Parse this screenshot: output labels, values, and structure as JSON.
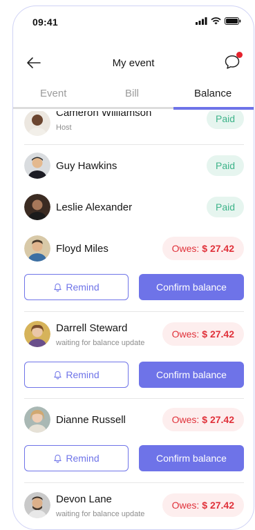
{
  "status_bar": {
    "time": "09:41"
  },
  "header": {
    "title": "My event"
  },
  "tabs": [
    {
      "label": "Event"
    },
    {
      "label": "Bill"
    },
    {
      "label": "Balance"
    }
  ],
  "buttons": {
    "remind": "Remind",
    "confirm": "Confirm balance"
  },
  "owes_label": "Owes:",
  "people": [
    {
      "name": "Cameron Williamson",
      "subtitle": "Host",
      "status": "Paid"
    },
    {
      "name": "Guy Hawkins",
      "status": "Paid"
    },
    {
      "name": "Leslie Alexander",
      "status": "Paid"
    },
    {
      "name": "Floyd Miles",
      "amount": "$ 27.42"
    },
    {
      "name": "Darrell Steward",
      "subtitle": "waiting for balance update",
      "amount": "$ 27.42"
    },
    {
      "name": "Dianne Russell",
      "amount": "$ 27.42"
    },
    {
      "name": "Devon Lane",
      "subtitle": "waiting for balance update",
      "amount": "$ 27.42"
    }
  ],
  "colors": {
    "accent": "#6e73e8",
    "paid_bg": "#e6f5ef",
    "paid_text": "#3db389",
    "owes_bg": "#fdeeee",
    "owes_text": "#e0313a",
    "notification": "#e5222d"
  }
}
